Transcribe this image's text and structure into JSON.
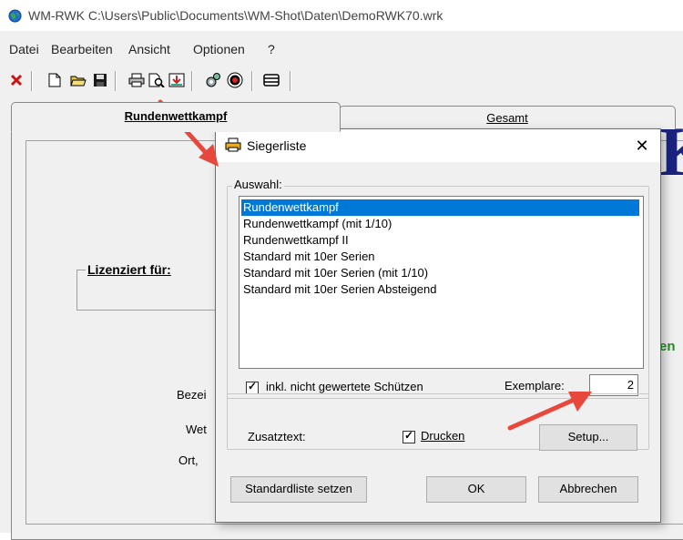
{
  "window": {
    "title": "WM-RWK C:\\Users\\Public\\Documents\\WM-Shot\\Daten\\DemoRWK70.wrk"
  },
  "menu": {
    "items": [
      "Datei",
      "Bearbeiten",
      "Ansicht",
      "Optionen",
      "?"
    ]
  },
  "toolbar": {
    "icons": [
      "close-icon",
      "new-file-icon",
      "open-folder-icon",
      "save-icon",
      "print-icon",
      "print-preview-icon",
      "export-icon",
      "settings-icon",
      "target-icon",
      "list-icon"
    ]
  },
  "tabs": [
    {
      "label": "Rundenwettkampf",
      "active": true
    },
    {
      "label": "Gesamt",
      "active": false
    }
  ],
  "background": {
    "lizenziert_label": "Lizenziert für:",
    "bezeichnung_partial": "Bezei",
    "wettkampf_partial": "Wet",
    "ort_partial": "Ort,",
    "green_partial": "en",
    "big_letter": "K"
  },
  "dialog": {
    "title": "Siegerliste",
    "group_label": "Auswahl:",
    "list_items": [
      "Rundenwettkampf",
      "Rundenwettkampf (mit 1/10)",
      "Rundenwettkampf II",
      "Standard mit 10er Serien",
      "Standard mit 10er Serien (mit 1/10)",
      "Standard mit 10er Serien Absteigend"
    ],
    "selected_index": 0,
    "include_label": "inkl. nicht gewertete Schützen",
    "include_checked": true,
    "copies_label": "Exemplare:",
    "copies_value": "2",
    "zusatz_label": "Zusatztext:",
    "print_label": "Drucken",
    "print_checked": true,
    "setup_label": "Setup...",
    "standard_button": "Standardliste setzen",
    "ok_button": "OK",
    "cancel_button": "Abbrechen"
  },
  "colors": {
    "accent": "#0078d7",
    "annotation_arrow": "#e8483b",
    "green_text": "#2a8a2a",
    "logo_blue": "#1a237e"
  }
}
